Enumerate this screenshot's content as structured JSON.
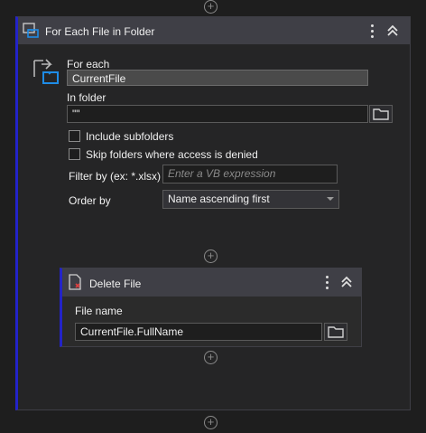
{
  "activity": {
    "title": "For Each File in Folder",
    "for_each_label": "For each",
    "for_each_value": "CurrentFile",
    "in_folder_label": "In folder",
    "in_folder_value": "\"\"",
    "include_subfolders_label": "Include subfolders",
    "include_subfolders_checked": false,
    "skip_folders_label": "Skip folders where access is denied",
    "skip_folders_checked": false,
    "filter_label": "Filter by (ex: *.xlsx)",
    "filter_placeholder": "Enter a VB expression",
    "order_label": "Order by",
    "order_value": "Name ascending first"
  },
  "child": {
    "title": "Delete File",
    "file_name_label": "File name",
    "file_name_value": "CurrentFile.FullName"
  },
  "icons": {
    "activity_icon": "folder-loop-icon",
    "child_icon": "delete-file-icon",
    "more": "kebab-menu-icon",
    "collapse": "chevron-double-up-icon",
    "browse": "folder-icon",
    "add": "plus-circle-icon"
  },
  "colors": {
    "accent_bar": "#2323c8",
    "header_bg": "#3f3f46",
    "canvas_bg": "#1e1e1e",
    "icon_blue": "#1e8ce6"
  }
}
